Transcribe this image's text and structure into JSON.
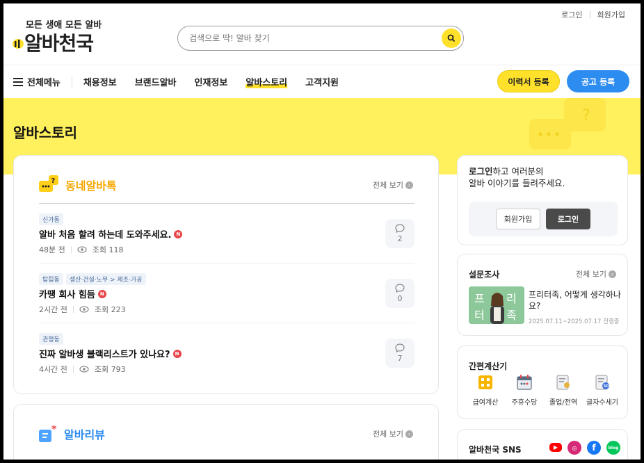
{
  "header": {
    "login_link": "로그인",
    "signup_link": "회원가입",
    "slogan": "모든 생애 모든 알바",
    "logo_name": "알바천국",
    "search_placeholder": "검색으로 딱! 알바 찾기"
  },
  "nav": {
    "all_menu": "전체메뉴",
    "items": [
      "채용정보",
      "브랜드알바",
      "인재정보",
      "알바스토리",
      "고객지원"
    ],
    "active_index": 3,
    "resume_button": "이력서 등록",
    "job_post_button": "공고 등록"
  },
  "banner": {
    "title": "알바스토리"
  },
  "neighborhood": {
    "title": "동네알바톡",
    "view_all": "전체 보기",
    "posts": [
      {
        "tags": [
          "신가동"
        ],
        "title": "알바 처음 할려 하는데 도와주세요.",
        "time": "48분 전",
        "views": "조회 118",
        "comments": "2"
      },
      {
        "tags": [
          "탑립동",
          "생산·건설·노무 > 제조·가공"
        ],
        "title": "카땡 회사 힘듬",
        "time": "2시간 전",
        "views": "조회 223",
        "comments": "0"
      },
      {
        "tags": [
          "관평동"
        ],
        "title": "진짜 알바생 블랙리스트가 있나요?",
        "time": "4시간 전",
        "views": "조회 793",
        "comments": "7"
      }
    ]
  },
  "review": {
    "title": "알바리뷰",
    "view_all": "전체 보기"
  },
  "sidebar": {
    "login_msg_bold": "로그인",
    "login_msg_rest": "하고 여러분의",
    "login_msg_line2": "알바 이야기를 들려주세요.",
    "signup_button": "회원가입",
    "login_button": "로그인",
    "survey": {
      "title": "설문조사",
      "view_all": "전체 보기",
      "img_chars": [
        "프",
        "리",
        "터",
        "족"
      ],
      "question": "프리터족, 어떻게 생각하나요?",
      "date": "2025.07.11~2025.07.17 진행중"
    },
    "calculator": {
      "title": "간편계산기",
      "items": [
        {
          "label": "급여계산",
          "color": "#f7b500"
        },
        {
          "label": "주휴수당",
          "color": "#5a6b7f"
        },
        {
          "label": "졸업/전역",
          "color": "#c9a24a"
        },
        {
          "label": "글자수세기",
          "color": "#3b6fd9"
        }
      ]
    },
    "sns": {
      "title": "알바천국 SNS",
      "icons": [
        {
          "name": "youtube",
          "glyph": "▶",
          "color": "#ff0000"
        },
        {
          "name": "instagram",
          "glyph": "◎",
          "color": "#d62976"
        },
        {
          "name": "facebook",
          "glyph": "f",
          "color": "#1877f2"
        },
        {
          "name": "blog",
          "glyph": "blog",
          "color": "#03c75a"
        }
      ]
    }
  },
  "colors": {
    "brand_yellow": "#ffe12b",
    "banner_yellow": "#fff15d",
    "brand_blue": "#2d8cf0"
  }
}
